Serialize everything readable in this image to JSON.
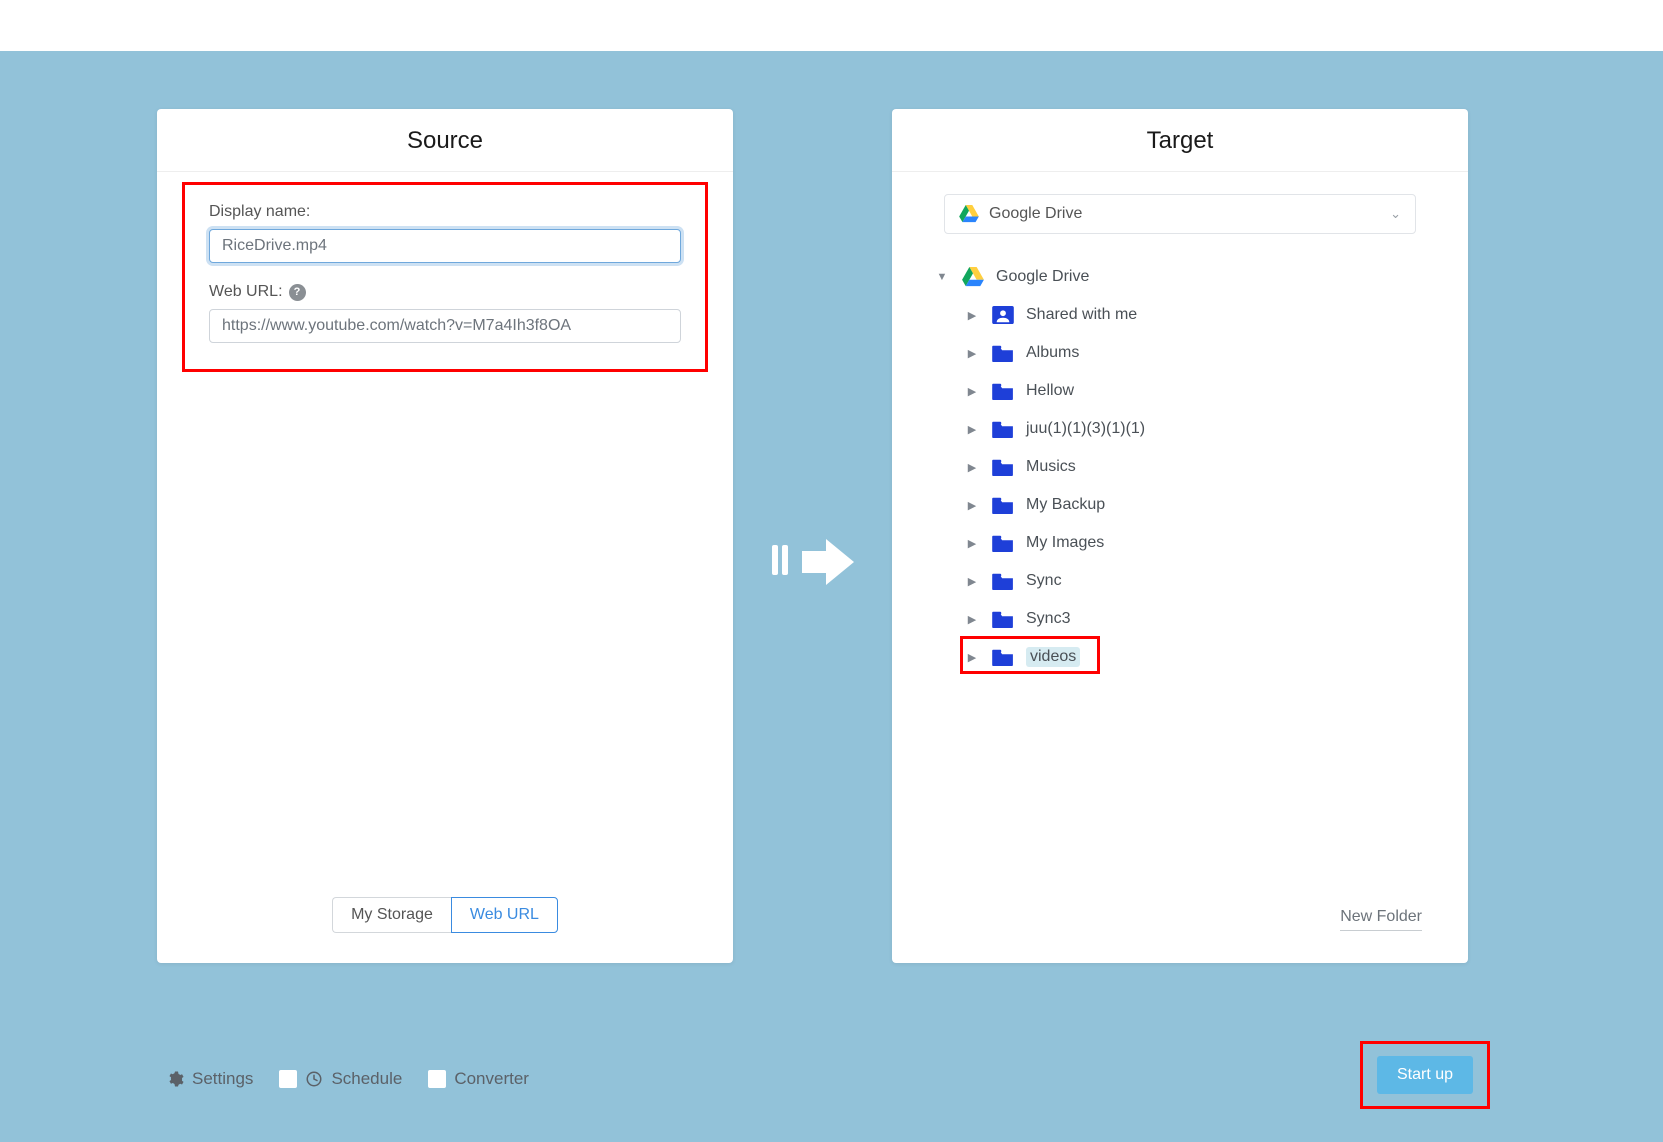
{
  "source": {
    "title": "Source",
    "display_name_label": "Display name:",
    "display_name_value": "RiceDrive.mp4",
    "web_url_label": "Web URL:",
    "web_url_value": "https://www.youtube.com/watch?v=M7a4Ih3f8OA",
    "tabs": {
      "my_storage": "My Storage",
      "web_url": "Web URL",
      "active": "web_url"
    }
  },
  "target": {
    "title": "Target",
    "selector_label": "Google Drive",
    "root_label": "Google Drive",
    "folders": [
      {
        "label": "Shared with me",
        "icon": "shared"
      },
      {
        "label": "Albums",
        "icon": "folder"
      },
      {
        "label": "Hellow",
        "icon": "folder"
      },
      {
        "label": "juu(1)(1)(3)(1)(1)",
        "icon": "folder"
      },
      {
        "label": "Musics",
        "icon": "folder"
      },
      {
        "label": "My Backup",
        "icon": "folder"
      },
      {
        "label": "My Images",
        "icon": "folder"
      },
      {
        "label": "Sync",
        "icon": "folder"
      },
      {
        "label": "Sync3",
        "icon": "folder"
      },
      {
        "label": "videos",
        "icon": "folder",
        "selected": true
      }
    ],
    "new_folder_label": "New Folder"
  },
  "bottom": {
    "settings": "Settings",
    "schedule": "Schedule",
    "converter": "Converter",
    "startup": "Start up"
  }
}
